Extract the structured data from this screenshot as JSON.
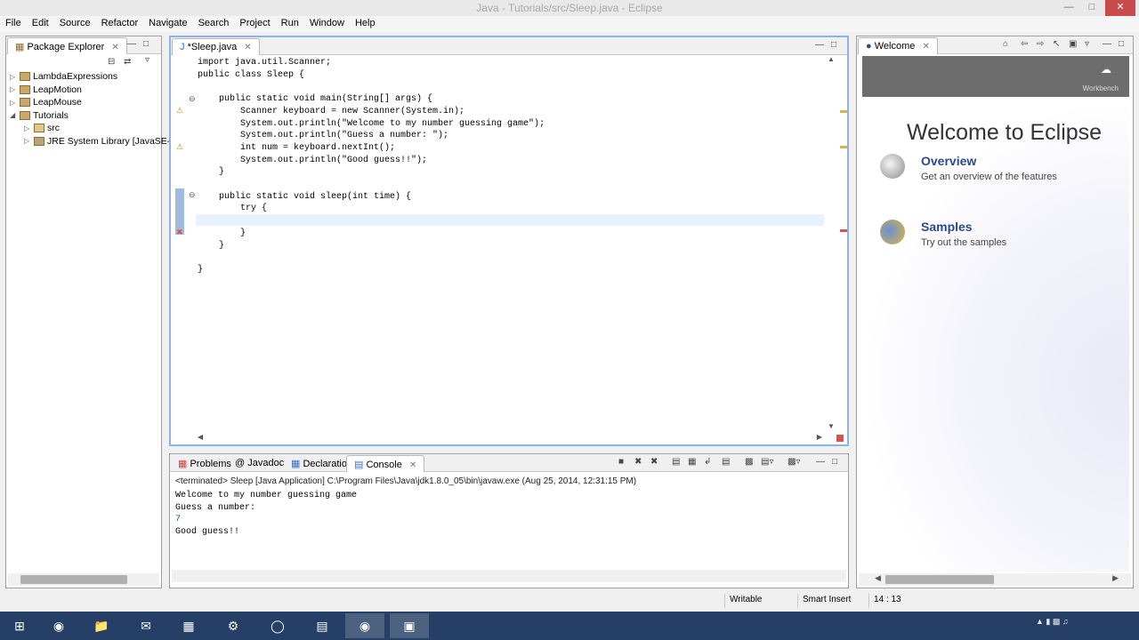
{
  "window": {
    "title": "Java - Tutorials/src/Sleep.java - Eclipse"
  },
  "menu": [
    "File",
    "Edit",
    "Source",
    "Refactor",
    "Navigate",
    "Search",
    "Project",
    "Run",
    "Window",
    "Help"
  ],
  "package_explorer": {
    "tab_label": "Package Explorer",
    "items": [
      {
        "label": "LambdaExpressions"
      },
      {
        "label": "LeapMotion"
      },
      {
        "label": "LeapMouse"
      },
      {
        "label": "Tutorials"
      },
      {
        "label": "src"
      },
      {
        "label": "JRE System Library [JavaSE-"
      }
    ]
  },
  "editor": {
    "tab_label": "*Sleep.java",
    "code_lines": [
      "import java.util.Scanner;",
      "public class Sleep {",
      "",
      "    public static void main(String[] args) {",
      "        Scanner keyboard = new Scanner(System.in);",
      "        System.out.println(\"Welcome to my number guessing game\");",
      "        System.out.println(\"Guess a number: \");",
      "        int num = keyboard.nextInt();",
      "        System.out.println(\"Good guess!!\");",
      "    }",
      "",
      "    public static void sleep(int time) {",
      "        try {",
      "",
      "        }",
      "    }",
      "",
      "}"
    ]
  },
  "bottom_tabs": {
    "problems": "Problems",
    "javadoc": "Javadoc",
    "declaration": "Declaration",
    "console": "Console"
  },
  "console": {
    "header": "<terminated> Sleep [Java Application] C:\\Program Files\\Java\\jdk1.8.0_05\\bin\\javaw.exe (Aug 25, 2014, 12:31:15 PM)",
    "lines": [
      "Welcome to my number guessing game",
      "Guess a number:",
      "7",
      "Good guess!!"
    ]
  },
  "welcome": {
    "tab_label": "Welcome",
    "title": "Welcome to Eclipse",
    "band_label": "Workbench",
    "links": [
      {
        "label": "Overview",
        "desc": "Get an overview of the features"
      },
      {
        "label": "Samples",
        "desc": "Try out the samples"
      }
    ]
  },
  "status": {
    "writable": "Writable",
    "insert_mode": "Smart Insert",
    "position": "14 : 13"
  },
  "colors": {
    "editor_focus_border": "#8cb4e0",
    "taskbar": "#263f66",
    "welcome_link": "#2b4a8b"
  }
}
